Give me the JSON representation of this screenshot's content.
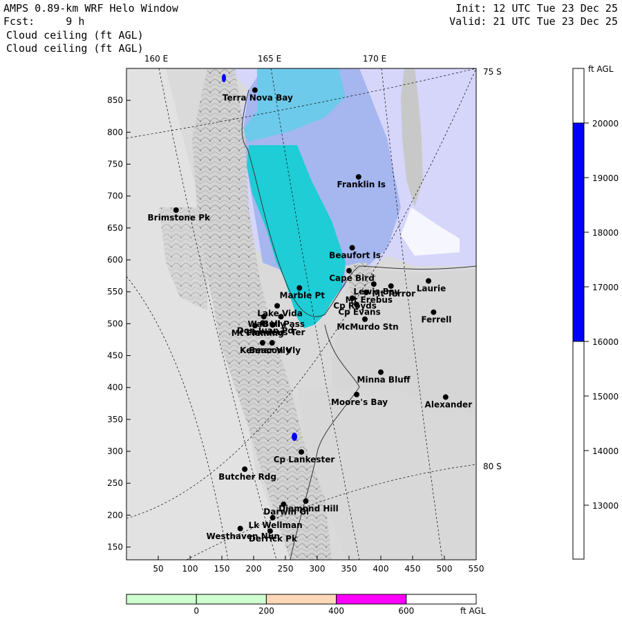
{
  "header": {
    "title": "AMPS 0.89-km WRF Helo Window",
    "fcst": "Fcst:     9 h",
    "field1": "Cloud ceiling (ft AGL)",
    "field2": "Cloud ceiling (ft AGL)",
    "init": "Init: 12 UTC Tue 23 Dec 25",
    "valid": "Valid: 21 UTC Tue 23 Dec 25"
  },
  "map": {
    "x_ticks": [
      "50",
      "100",
      "150",
      "200",
      "250",
      "300",
      "350",
      "400",
      "450",
      "500",
      "550"
    ],
    "y_ticks": [
      "850",
      "800",
      "750",
      "700",
      "650",
      "600",
      "550",
      "500",
      "450",
      "400",
      "350",
      "300",
      "250",
      "200",
      "150"
    ],
    "lon_labels": [
      "160 E",
      "165 E",
      "170 E"
    ],
    "lat_labels": [
      "75 S",
      "80 S"
    ],
    "colors": {
      "land": "#d6d6d6",
      "cyan": "#1ecdd6",
      "sky": "#6ecaea",
      "lavender": "#d6d6fb",
      "seaice": "#c8c8c8"
    },
    "stations": [
      {
        "name": "Terra Nova Bay",
        "x": 202,
        "y": 866
      },
      {
        "name": "Franklin Is",
        "x": 365,
        "y": 730
      },
      {
        "name": "Brimstone Pk",
        "x": 78,
        "y": 678
      },
      {
        "name": "Beaufort Is",
        "x": 355,
        "y": 619
      },
      {
        "name": "Cape Bird",
        "x": 350,
        "y": 583
      },
      {
        "name": "Lewis Bay",
        "x": 389,
        "y": 562
      },
      {
        "name": "Laurie",
        "x": 475,
        "y": 567
      },
      {
        "name": "Mt Terror",
        "x": 416,
        "y": 559
      },
      {
        "name": "Marble Pt",
        "x": 272,
        "y": 556
      },
      {
        "name": "Mt Erebus",
        "x": 377,
        "y": 549
      },
      {
        "name": "Cp Royds",
        "x": 355,
        "y": 540
      },
      {
        "name": "Cp Evans",
        "x": 362,
        "y": 530
      },
      {
        "name": "Ferrell",
        "x": 483,
        "y": 518
      },
      {
        "name": "Lake Vida",
        "x": 237,
        "y": 528
      },
      {
        "name": "Wall Vly",
        "x": 216,
        "y": 511
      },
      {
        "name": "McMurdo Stn",
        "x": 375,
        "y": 507
      },
      {
        "name": "Bull Pass",
        "x": 243,
        "y": 511
      },
      {
        "name": "Don Juan Pd",
        "x": 214,
        "y": 501
      },
      {
        "name": "Mt Fleming",
        "x": 202,
        "y": 497
      },
      {
        "name": "Linnaeus Ter",
        "x": 230,
        "y": 498
      },
      {
        "name": "Kennar Vly",
        "x": 214,
        "y": 470
      },
      {
        "name": "Beacon Vly",
        "x": 229,
        "y": 470
      },
      {
        "name": "Minna Bluff",
        "x": 400,
        "y": 424
      },
      {
        "name": "Moore's Bay",
        "x": 362,
        "y": 389
      },
      {
        "name": "Alexander",
        "x": 502,
        "y": 385
      },
      {
        "name": "Cp Lankester",
        "x": 275,
        "y": 299
      },
      {
        "name": "Butcher Rdg",
        "x": 186,
        "y": 272
      },
      {
        "name": "Darwin Gl",
        "x": 247,
        "y": 217
      },
      {
        "name": "Diamond Hill",
        "x": 282,
        "y": 222
      },
      {
        "name": "Lk Wellman",
        "x": 230,
        "y": 196
      },
      {
        "name": "Westhaven Nun",
        "x": 179,
        "y": 179
      },
      {
        "name": "Derrick Pk",
        "x": 226,
        "y": 175
      }
    ]
  },
  "colorbar_right": {
    "unit": "ft AGL",
    "labels": [
      "20000",
      "19000",
      "18000",
      "17000",
      "16000",
      "15000",
      "14000",
      "13000"
    ],
    "fill_range": [
      16000,
      20000
    ],
    "fill_color": "#0000ff"
  },
  "colorbar_bottom": {
    "unit": "ft AGL",
    "labels": [
      "0",
      "200",
      "400",
      "600"
    ],
    "colors": [
      "#d0ffd0",
      "#d0ffd0",
      "#fcd8b8",
      "#ff00ff",
      "#ffffff"
    ]
  }
}
